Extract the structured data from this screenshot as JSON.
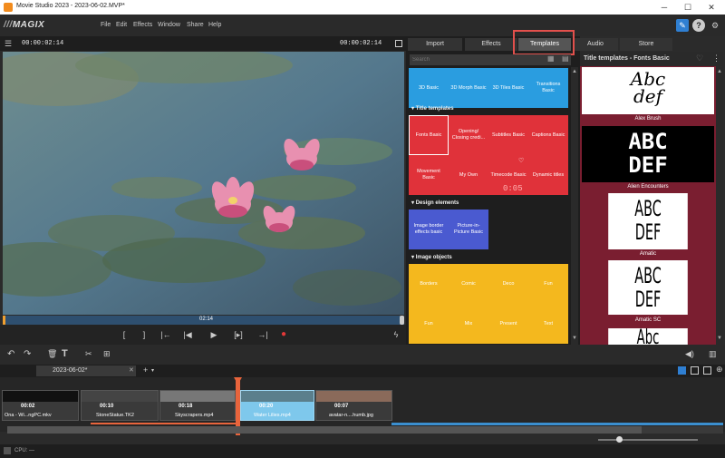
{
  "window": {
    "title": "Movie Studio 2023 - 2023-06-02.MVP*"
  },
  "menu": {
    "logo": "MAGIX",
    "items": [
      "File",
      "Edit",
      "Effects",
      "Window",
      "Share",
      "Help"
    ]
  },
  "preview": {
    "timecode_left": "00:00:02:14",
    "timecode_right": "00:00:02:14",
    "scrub_time": "02:14"
  },
  "media_tabs": [
    {
      "label": "Import"
    },
    {
      "label": "Effects"
    },
    {
      "label": "Templates"
    },
    {
      "label": "Audio"
    },
    {
      "label": "Store"
    }
  ],
  "search": {
    "placeholder": "Search"
  },
  "top_tiles": [
    "3D Basic",
    "3D Morph Basic",
    "3D Tiles Basic",
    "Transitions Basic"
  ],
  "sections": {
    "title_templates": "Title templates",
    "design_elements": "Design elements",
    "image_objects": "Image objects"
  },
  "title_tiles": [
    "Fonts Basic",
    "Opening/ Closing credi...",
    "Subtitles Basic",
    "Captions Basic",
    "Movement Basic",
    "My Own",
    "Timecode Basic",
    "Dynamic titles"
  ],
  "timecode_tile_digits": "0:05",
  "design_tiles": [
    "Image border effects basic",
    "Picture-in-Picture Basic"
  ],
  "image_tiles": [
    "Borders",
    "Comic",
    "Deco",
    "Fun",
    "Fun",
    "Mix",
    "Present",
    "Text"
  ],
  "template_panel": {
    "title": "Title templates - Fonts Basic",
    "fonts": [
      {
        "preview": "Abc\ndef",
        "name": "Alex Brush"
      },
      {
        "preview": "ABC\nDEF",
        "name": "Alien Encounters"
      },
      {
        "preview": "ABC\nDEF",
        "name": "Amatic"
      },
      {
        "preview": "ABC\nDEF",
        "name": "Amatic SC"
      },
      {
        "preview": "Abc",
        "name": ""
      }
    ]
  },
  "timeline": {
    "project_tab": "2023-06-02*",
    "clips": [
      {
        "duration": "00:02",
        "name": "Ona - Wi...ngPC.mkv"
      },
      {
        "duration": "00:10",
        "name": "StoneStatue.TK2"
      },
      {
        "duration": "00:18",
        "name": "Skyscrapers.mp4"
      },
      {
        "duration": "00:20",
        "name": "Water Lilies.mp4"
      },
      {
        "duration": "00:07",
        "name": "avatar-n....humb.jpg"
      }
    ]
  },
  "status": {
    "cpu": "CPU: —"
  },
  "colors": {
    "accent": "#2f7fd2",
    "playhead": "#e8643c",
    "highlight": "#e2504c",
    "record": "#e23838"
  }
}
